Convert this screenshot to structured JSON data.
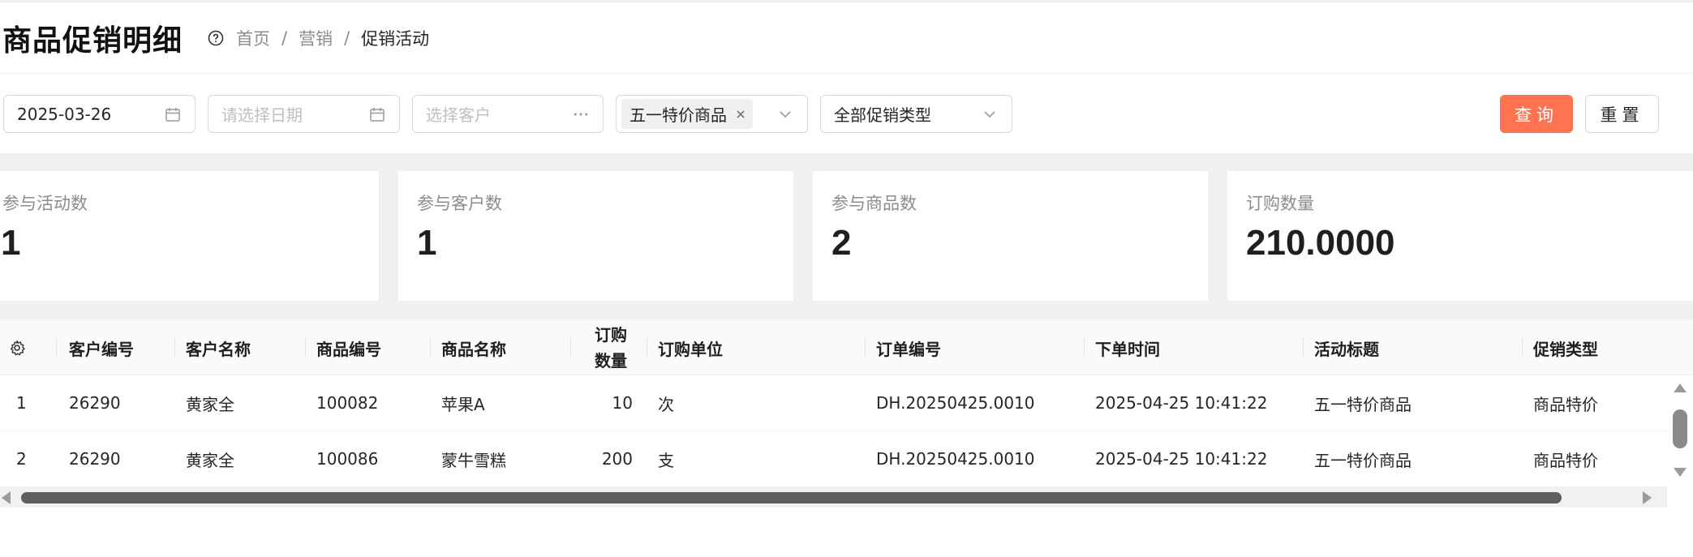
{
  "header": {
    "title": "商品促销明细",
    "breadcrumb": [
      "首页",
      "营销",
      "促销活动"
    ],
    "separator": "/"
  },
  "filters": {
    "start_date": "2025-03-26",
    "end_date_placeholder": "请选择日期",
    "customer_placeholder": "选择客户",
    "activity_tag": "五一特价商品",
    "promo_type": "全部促销类型",
    "query_label": "查询",
    "reset_label": "重置"
  },
  "stats": [
    {
      "label": "参与活动数",
      "value": "1"
    },
    {
      "label": "参与客户数",
      "value": "1"
    },
    {
      "label": "参与商品数",
      "value": "2"
    },
    {
      "label": "订购数量",
      "value": "210.0000"
    }
  ],
  "table": {
    "columns": {
      "customer_code": "客户编号",
      "customer_name": "客户名称",
      "product_code": "商品编号",
      "product_name": "商品名称",
      "qty_line1": "订购",
      "qty_line2": "数量",
      "unit": "订购单位",
      "order_no": "订单编号",
      "order_time": "下单时间",
      "activity_title": "活动标题",
      "promo_type": "促销类型"
    },
    "rows": [
      {
        "index": "1",
        "customer_code": "26290",
        "customer_name": "黄家全",
        "product_code": "100082",
        "product_name": "苹果A",
        "qty": "10",
        "unit": "次",
        "order_no": "DH.20250425.0010",
        "order_time": "2025-04-25 10:41:22",
        "activity_title": "五一特价商品",
        "promo_type": "商品特价"
      },
      {
        "index": "2",
        "customer_code": "26290",
        "customer_name": "黄家全",
        "product_code": "100086",
        "product_name": "蒙牛雪糕",
        "qty": "200",
        "unit": "支",
        "order_no": "DH.20250425.0010",
        "order_time": "2025-04-25 10:41:22",
        "activity_title": "五一特价商品",
        "promo_type": "商品特价"
      }
    ]
  },
  "colors": {
    "primary": "#ff7350",
    "band": "#f0f0f0"
  }
}
